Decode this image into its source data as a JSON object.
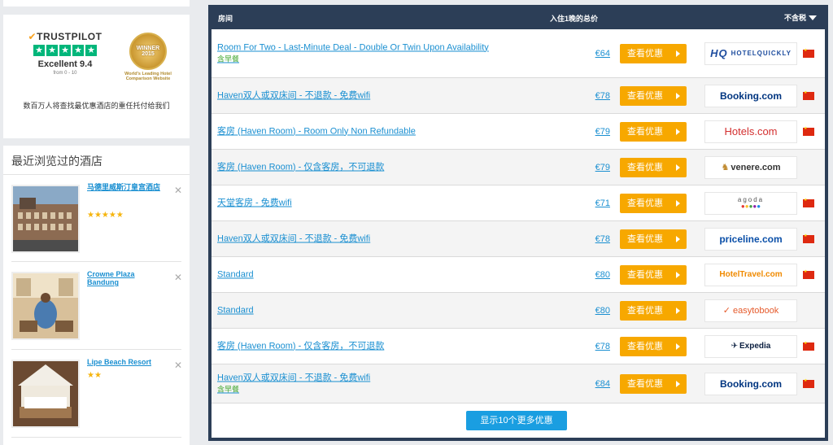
{
  "trust": {
    "brand": "TRUSTPILOT",
    "score_label": "Excellent 9.4",
    "range": "from 0 - 10",
    "award_top": "WORLD TRAVEL AWARDS",
    "award_mid": "WINNER 2015",
    "award_caption": "World's Leading Hotel Comparison Website",
    "caption": "数百万人将查找最优惠酒店的重任托付给我们"
  },
  "recent": {
    "title": "最近浏览过的酒店",
    "hotels": [
      {
        "name": "马德里威斯汀皇宫酒店",
        "stars": "★★★★★"
      },
      {
        "name": "Crowne Plaza Bandung",
        "stars": ""
      },
      {
        "name": "Lipe Beach Resort",
        "stars": "★★"
      }
    ]
  },
  "table": {
    "col_room": "房间",
    "col_price": "入住1晚的总价",
    "col_tax": "不含税",
    "deal_label": "查看优惠",
    "more_label": "显示10个更多优惠",
    "rows": [
      {
        "room": "Room For Two - Last-Minute Deal - Double Or Twin Upon Availability",
        "sub": "含早餐",
        "price": "€64",
        "provider": "HOTELQUICKLY",
        "flag": true
      },
      {
        "room": "Haven双人或双床间 - 不退款 - 免费wifi",
        "sub": "",
        "price": "€78",
        "provider": "Booking.com",
        "flag": true
      },
      {
        "room": "客房 (Haven Room) - Room Only Non Refundable",
        "sub": "",
        "price": "€79",
        "provider": "Hotels.com",
        "flag": true
      },
      {
        "room": "客房 (Haven Room) - 仅含客房，不可退款",
        "sub": "",
        "price": "€79",
        "provider": "venere.com",
        "flag": false
      },
      {
        "room": "天堂客房 - 免费wifi",
        "sub": "",
        "price": "€71",
        "provider": "agoda",
        "flag": true
      },
      {
        "room": "Haven双人或双床间 - 不退款 - 免费wifi",
        "sub": "",
        "price": "€78",
        "provider": "priceline.com",
        "flag": true
      },
      {
        "room": "Standard",
        "sub": "",
        "price": "€80",
        "provider": "HotelTravel.com",
        "flag": true
      },
      {
        "room": "Standard",
        "sub": "",
        "price": "€80",
        "provider": "easytobook",
        "flag": false
      },
      {
        "room": "客房 (Haven Room) - 仅含客房，不可退款",
        "sub": "",
        "price": "€78",
        "provider": "Expedia",
        "flag": true
      },
      {
        "room": "Haven双人或双床间 - 不退款 - 免费wifi",
        "sub": "含早餐",
        "price": "€84",
        "provider": "Booking.com",
        "flag": true
      }
    ]
  },
  "colors": {
    "header_bg": "#2c3e57",
    "deal_button": "#f7a800",
    "link": "#1a8fd1",
    "more_button": "#1a9ee1",
    "trustpilot_green": "#00b67a"
  }
}
